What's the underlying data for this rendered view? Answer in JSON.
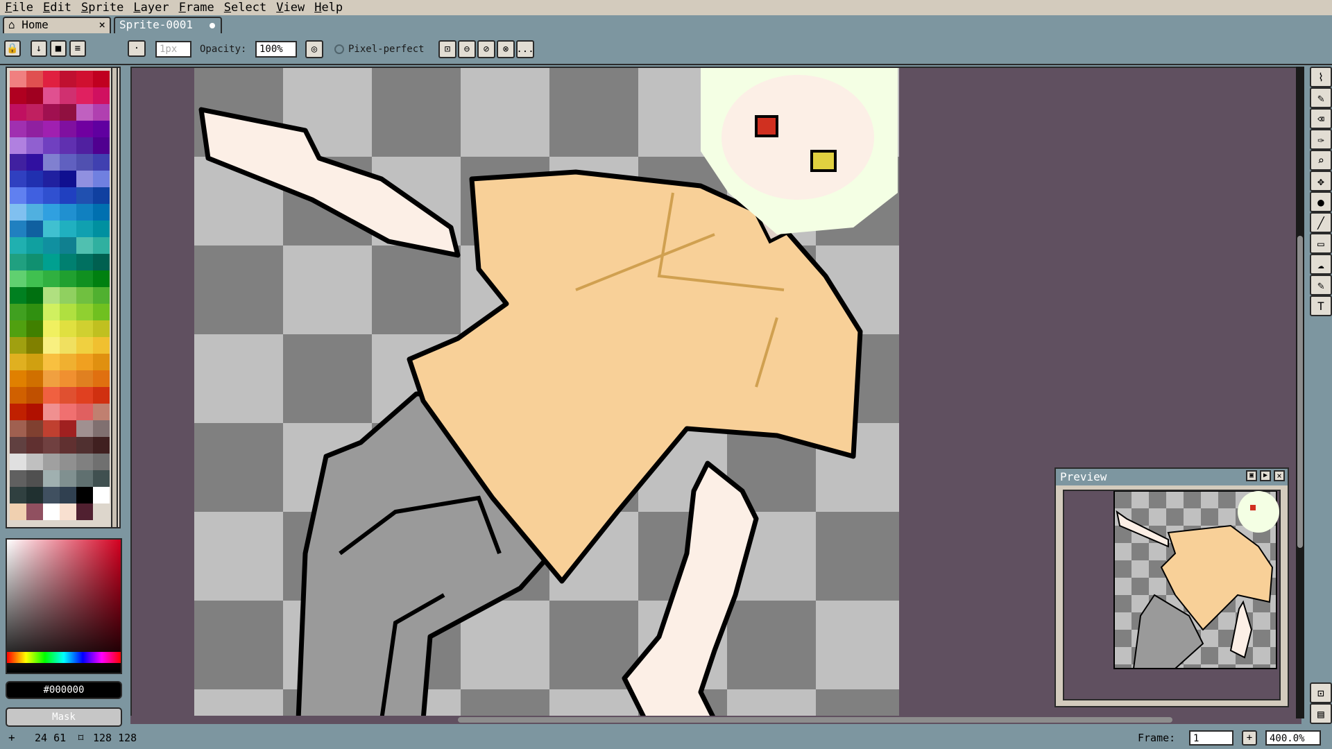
{
  "menu": [
    "File",
    "Edit",
    "Sprite",
    "Layer",
    "Frame",
    "Select",
    "View",
    "Help"
  ],
  "tabs": [
    {
      "label": "Home",
      "close": "×"
    },
    {
      "label": "Sprite-0001"
    }
  ],
  "toolbar": {
    "brush_size": "1px",
    "opacity_label": "Opacity:",
    "opacity_value": "100%",
    "pixel_perfect_label": "Pixel-perfect",
    "more": "..."
  },
  "palette_colors": [
    "#f08080",
    "#e05050",
    "#e02040",
    "#c01030",
    "#d01030",
    "#c00020",
    "#b00020",
    "#a00020",
    "#e05090",
    "#d03070",
    "#e02060",
    "#d01060",
    "#c01060",
    "#c02060",
    "#a01050",
    "#901040",
    "#c060c0",
    "#b040b0",
    "#a030b0",
    "#9020a0",
    "#a020b0",
    "#8010a0",
    "#7000a0",
    "#6000a0",
    "#b080e0",
    "#9060d0",
    "#7040c0",
    "#6030b0",
    "#5020a0",
    "#500090",
    "#4020a0",
    "#3010a0",
    "#8080d0",
    "#6060c0",
    "#5050b0",
    "#4040b0",
    "#3040c0",
    "#2030b0",
    "#2020a0",
    "#101090",
    "#9090e0",
    "#7080e0",
    "#6080f0",
    "#4060e0",
    "#3050d0",
    "#2040c0",
    "#2050b0",
    "#1040a0",
    "#80c0f0",
    "#50b0e0",
    "#30a0e0",
    "#2090d0",
    "#1080c0",
    "#0070b0",
    "#2080c0",
    "#1060a0",
    "#40c0d0",
    "#20b0c0",
    "#10a0b0",
    "#0090a0",
    "#20b0b0",
    "#10a0a0",
    "#1090a0",
    "#108090",
    "#50c0b0",
    "#30b0a0",
    "#20a080",
    "#109070",
    "#00a090",
    "#008070",
    "#007060",
    "#006050",
    "#60d070",
    "#40c050",
    "#30b040",
    "#20a030",
    "#109020",
    "#008010",
    "#008020",
    "#007010",
    "#b0e080",
    "#90d060",
    "#70c040",
    "#50b030",
    "#40a020",
    "#309010",
    "#d0f060",
    "#b0e040",
    "#90d030",
    "#70c020",
    "#50a010",
    "#408000",
    "#f0f060",
    "#e0e040",
    "#d0d030",
    "#c0c020",
    "#a0a010",
    "#808000",
    "#f8f080",
    "#f0e060",
    "#f0d040",
    "#f0c030",
    "#e0b020",
    "#d0a010",
    "#f8c040",
    "#f0b030",
    "#f0a020",
    "#e09010",
    "#e08000",
    "#d07000",
    "#f0a040",
    "#f09030",
    "#e08020",
    "#e07010",
    "#d06000",
    "#c05000",
    "#f06040",
    "#e05030",
    "#e04020",
    "#d03010",
    "#c02000",
    "#b01000",
    "#f09090",
    "#f07070",
    "#e06060",
    "#c08070",
    "#a06050",
    "#804030",
    "#c04030",
    "#a02020",
    "#a09090",
    "#807070",
    "#604040",
    "#603030",
    "#704040",
    "#603030",
    "#503030",
    "#402020",
    "#e0e0e0",
    "#c0c0c0",
    "#a0a0a0",
    "#909090",
    "#808080",
    "#707070",
    "#606060",
    "#505050",
    "#a0b0b0",
    "#809090",
    "#607070",
    "#405050",
    "#304040",
    "#203030",
    "#405060",
    "#304050",
    "#000000",
    "#ffffff",
    "#f0d0b0",
    "#905060",
    "#ffffff",
    "#f8e0d0",
    "#502030"
  ],
  "color": {
    "hex": "#000000",
    "mask_label": "Mask"
  },
  "preview": {
    "title": "Preview"
  },
  "status": {
    "cursor": "24 61",
    "size": "128 128",
    "frame_label": "Frame:",
    "frame_value": "1",
    "zoom": "400.0%"
  },
  "tools": [
    "lasso-tool-icon",
    "pencil-icon",
    "eraser-icon",
    "eyedropper-icon",
    "zoom-icon",
    "move-icon",
    "fill-icon",
    "line-icon",
    "rectangle-icon",
    "blur-icon",
    "brush-icon",
    "text-icon"
  ],
  "colors": {
    "bg": "#7d96a0",
    "panel": "#d3cbbd",
    "canvas_bg": "#605060",
    "checker_light": "#c0c0c0",
    "checker_dark": "#808080",
    "shirt": "#f8d098",
    "skin": "#fcefe6",
    "hair": "#f4ffe4"
  }
}
